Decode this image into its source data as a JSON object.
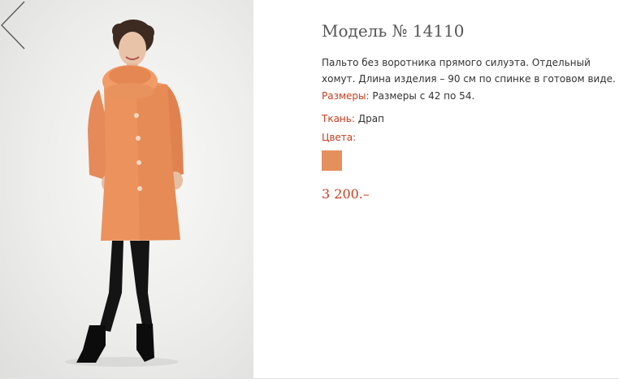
{
  "product": {
    "title": "Модель № 14110",
    "description": "Пальто без воротника прямого силуэта. Отдельный хомут. Длина изделия – 90 см по спинке в готовом виде.",
    "sizes_label": "Размеры:",
    "sizes_value": "Размеры с 42 по 54.",
    "fabric_label": "Ткань:",
    "fabric_value": "Драп",
    "colors_label": "Цвета:",
    "colors": [
      "#e58f5c"
    ],
    "price": "3 200.–"
  },
  "gallery": {
    "prev_icon": "chevron-left-icon"
  }
}
